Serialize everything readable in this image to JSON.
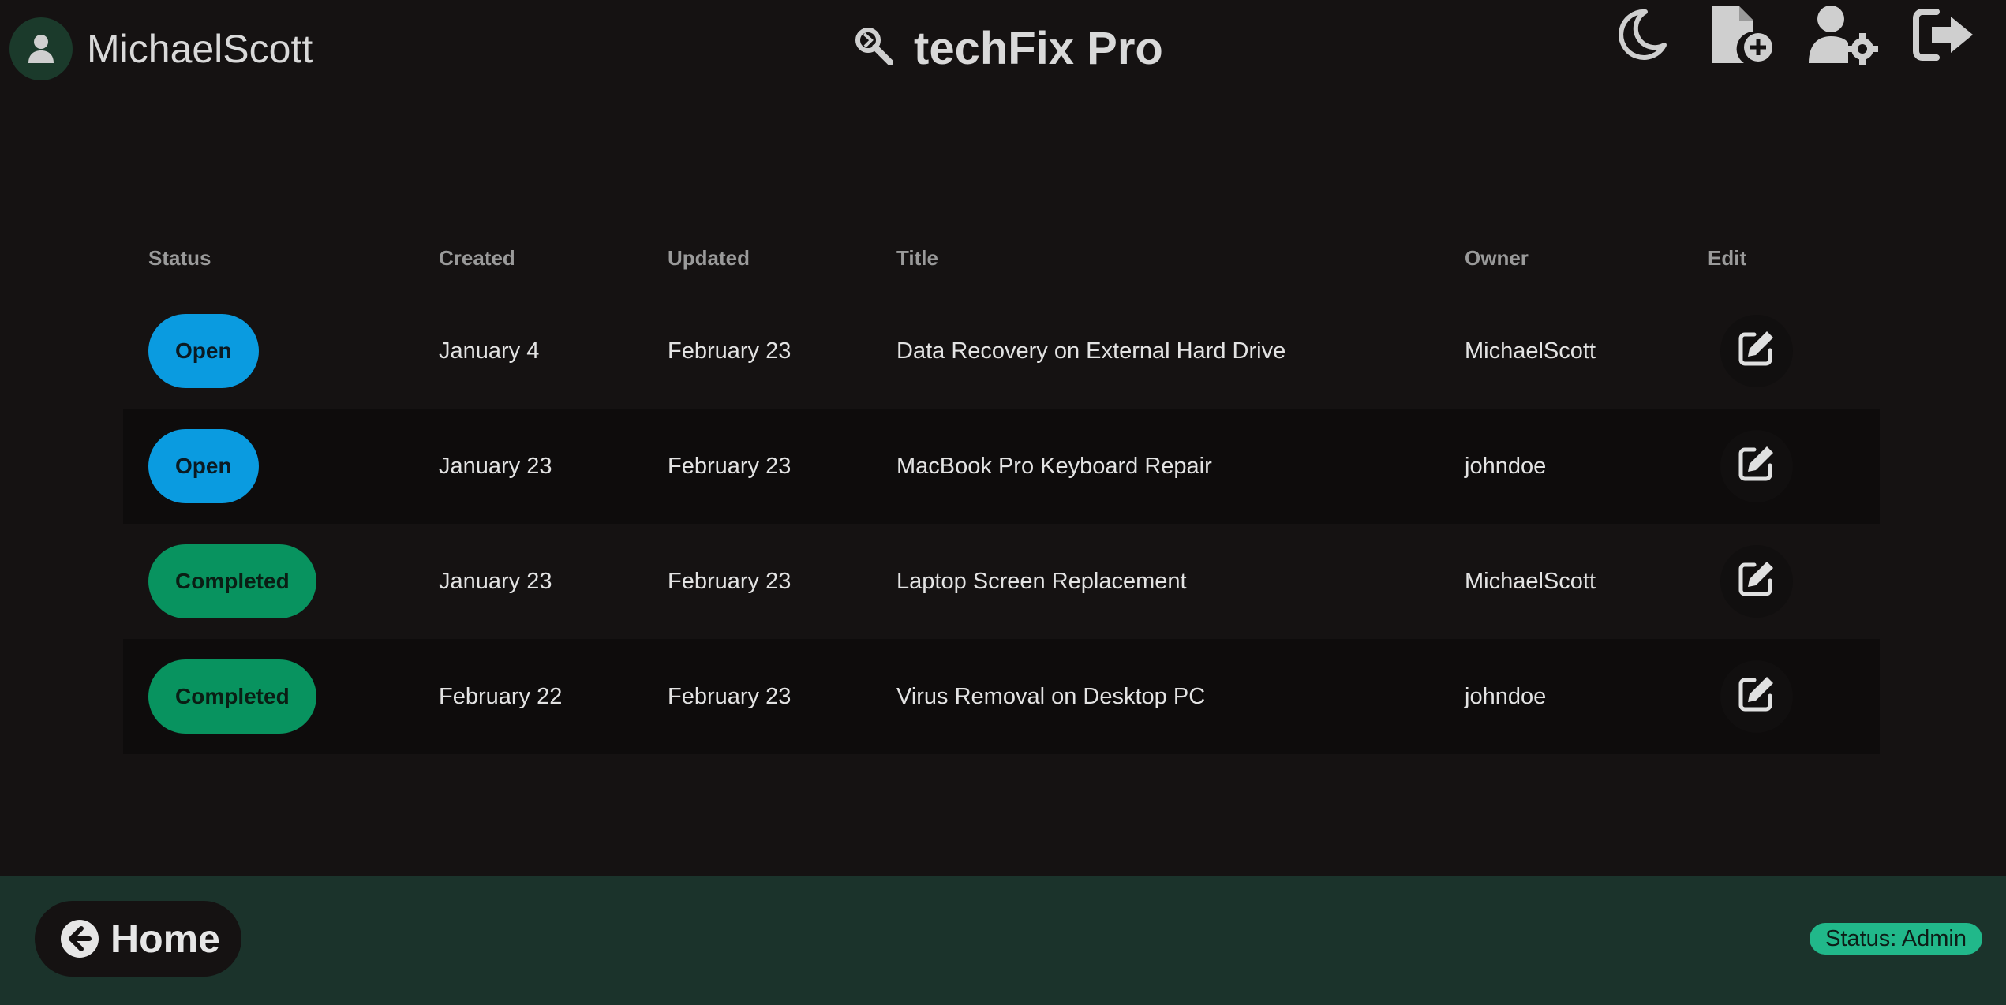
{
  "header": {
    "username": "MichaelScott",
    "app_title": "techFix Pro",
    "icons": {
      "avatar": "user-icon",
      "brand": "tools-icon",
      "theme": "moon-icon",
      "new_ticket": "file-plus-icon",
      "users": "user-gear-icon",
      "logout": "logout-icon"
    }
  },
  "table": {
    "columns": [
      "Status",
      "Created",
      "Updated",
      "Title",
      "Owner",
      "Edit"
    ],
    "rows": [
      {
        "status": "Open",
        "status_kind": "open",
        "created": "January 4",
        "updated": "February 23",
        "title": "Data Recovery on External Hard Drive",
        "owner": "MichaelScott"
      },
      {
        "status": "Open",
        "status_kind": "open",
        "created": "January 23",
        "updated": "February 23",
        "title": "MacBook Pro Keyboard Repair",
        "owner": "johndoe"
      },
      {
        "status": "Completed",
        "status_kind": "completed",
        "created": "January 23",
        "updated": "February 23",
        "title": "Laptop Screen Replacement",
        "owner": "MichaelScott"
      },
      {
        "status": "Completed",
        "status_kind": "completed",
        "created": "February 22",
        "updated": "February 23",
        "title": "Virus Removal on Desktop PC",
        "owner": "johndoe"
      }
    ]
  },
  "footer": {
    "home_label": "Home",
    "status_badge": "Status: Admin"
  },
  "colors": {
    "background": "#151212",
    "footer": "#1b332b",
    "open": "#0a9be0",
    "completed": "#08935f",
    "badge": "#21b88a"
  }
}
